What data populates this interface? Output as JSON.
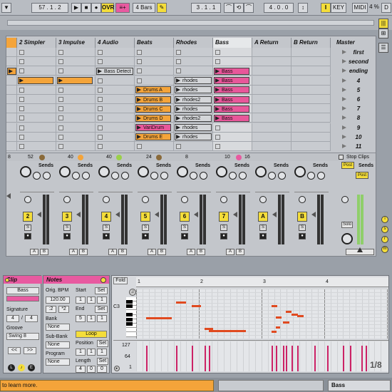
{
  "transport": {
    "position": "57 .  1 .  2",
    "ovr": "OVR",
    "quant": "4 Bars",
    "loop_start": "3 .  1 .  1",
    "loop_len": "4 .  0 .  0",
    "key": "KEY",
    "midi": "MIDI",
    "cpu": "4 %",
    "d_label": "D"
  },
  "tracks": [
    {
      "name": "",
      "color": "#f4a43a"
    },
    {
      "name": "2 Simpler"
    },
    {
      "name": "3 Impulse"
    },
    {
      "name": "4 Audio"
    },
    {
      "name": "Beats"
    },
    {
      "name": "Rhodes"
    },
    {
      "name": "Bass"
    },
    {
      "name": "A Return"
    },
    {
      "name": "B Return"
    }
  ],
  "master": {
    "name": "Master",
    "stop_clips": "Stop Clips"
  },
  "scenes": [
    "first",
    "second",
    "ending",
    "4",
    "5",
    "6",
    "7",
    "8",
    "9",
    "10",
    "11"
  ],
  "clips": {
    "simpler_row2": "",
    "audio_row1": "Bass Detect",
    "beats": [
      "Drums A",
      "Drums B",
      "Drums C",
      "Drums D",
      "VariDrum",
      "Drums E"
    ],
    "rhodes": [
      "rhodes",
      "rhodes",
      "rhodes2",
      "rhodes",
      "rhodes2",
      "rhodes",
      "rhodes"
    ],
    "bass": [
      "Bass",
      "Bass",
      "Bass",
      "Bass",
      "Bass",
      "Bass"
    ]
  },
  "mixer": {
    "io": [
      "8",
      "52",
      "40",
      "40",
      "24",
      "8",
      "10",
      "16"
    ],
    "sends_label": "Sends",
    "a": "A",
    "b": "B",
    "track_numbers": [
      "2",
      "3",
      "4",
      "5",
      "6",
      "7"
    ],
    "returns": [
      "A",
      "B"
    ],
    "post": "Post",
    "solo": "Solo",
    "s": "S"
  },
  "clipview": {
    "title": "Clip",
    "clip_name": "Bass",
    "signature_label": "Signature",
    "sig_num": "4",
    "sig_den": "4",
    "groove_label": "Groove",
    "groove": "Swing 8",
    "nav_prev": "<<",
    "nav_next": ">>"
  },
  "notes": {
    "title": "Notes",
    "orig_bpm_label": "Orig. BPM",
    "bpm": "120.00",
    "half": ":2",
    "double": "*2",
    "bank_label": "Bank",
    "bank": "None",
    "subbank_label": "Sub-Bank",
    "subbank": "None",
    "program_label": "Program",
    "program": "None",
    "start_label": "Start",
    "start": [
      "1",
      "1",
      "1"
    ],
    "end_label": "End",
    "end": [
      "5",
      "1",
      "1"
    ],
    "set": "Set",
    "loop": "Loop",
    "position_label": "Position",
    "position": [
      "1",
      "1",
      "1"
    ],
    "length_label": "Length",
    "length": [
      "4",
      "0",
      "0"
    ]
  },
  "editor": {
    "fold": "Fold",
    "markers": [
      "1",
      "2",
      "3",
      "4"
    ],
    "c3": "C3",
    "vel_top": "127",
    "vel_mid": "64",
    "vel_bot": "1",
    "grid": "1/8"
  },
  "status": {
    "text": "to learn more.",
    "bass_tab": "Bass",
    "sampler_tab": "Bass"
  }
}
